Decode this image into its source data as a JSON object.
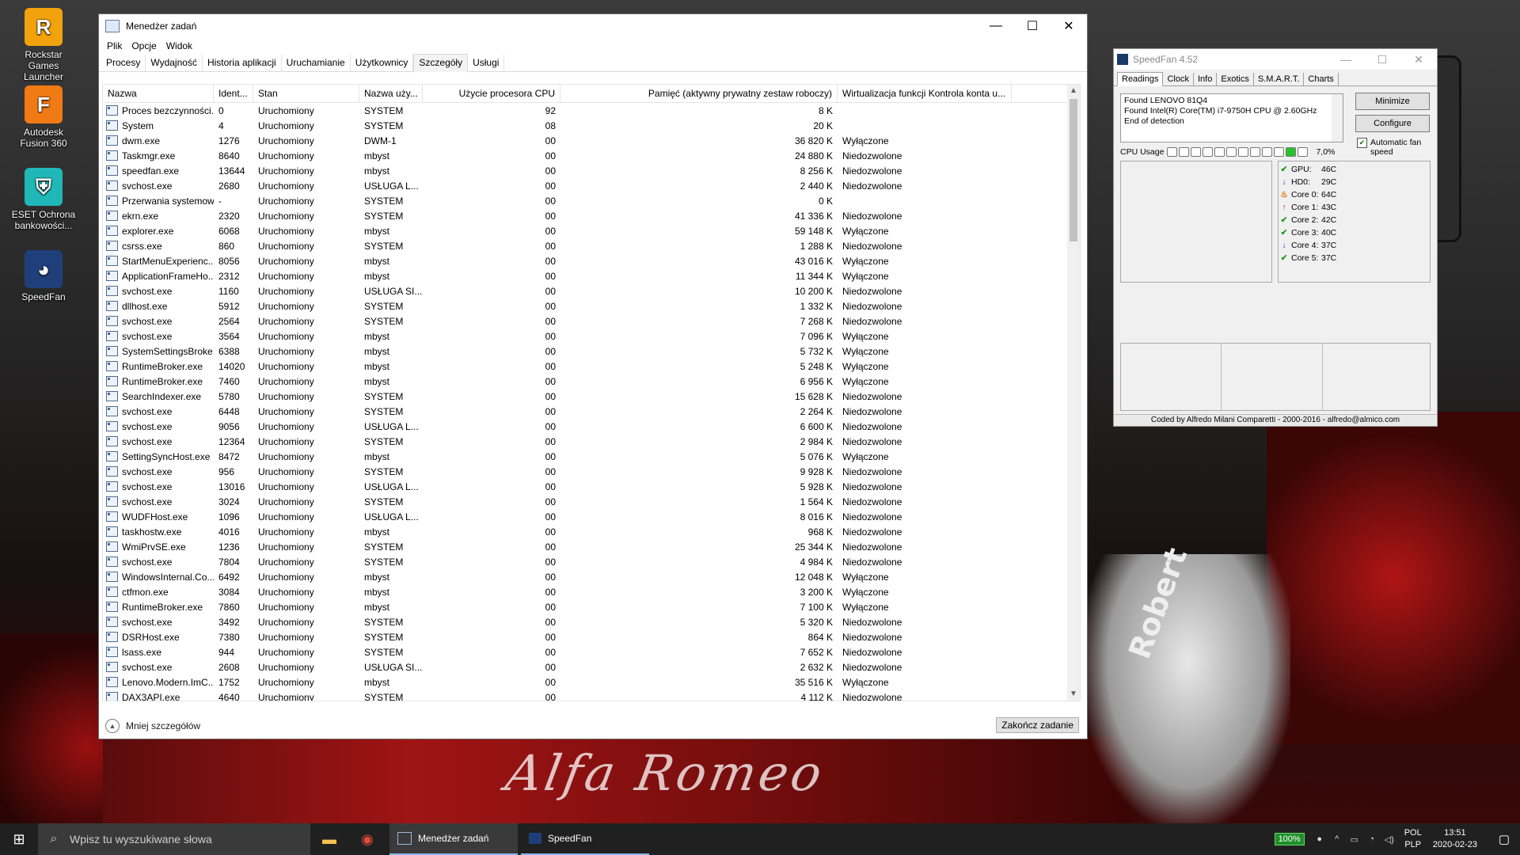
{
  "desktop": {
    "icons": [
      {
        "label": "Rockstar Games Launcher",
        "glyph": "R",
        "color": "#f1a20c"
      },
      {
        "label": "Autodesk Fusion 360",
        "glyph": "F",
        "color": "#f07a14"
      },
      {
        "label": "ESET Ochrona bankowości...",
        "glyph": "⛨",
        "color": "#1fb7b7"
      },
      {
        "label": "SpeedFan",
        "glyph": "◕",
        "color": "#1f3f7a"
      }
    ],
    "wallpaper_text": "Alfa Romeo",
    "glove_text": "Robert"
  },
  "taskmanager": {
    "title": "Menedżer zadań",
    "menu": [
      "Plik",
      "Opcje",
      "Widok"
    ],
    "tabs": [
      "Procesy",
      "Wydajność",
      "Historia aplikacji",
      "Uruchamianie",
      "Użytkownicy",
      "Szczegóły",
      "Usługi"
    ],
    "active_tab": "Szczegóły",
    "columns": [
      "Nazwa",
      "Ident...",
      "Stan",
      "Nazwa uży...",
      "Użycie procesora CPU",
      "Pamięć (aktywny prywatny zestaw roboczy)",
      "Wirtualizacja funkcji Kontrola konta u..."
    ],
    "rows": [
      [
        "Proces bezczynności...",
        "0",
        "Uruchomiony",
        "SYSTEM",
        "92",
        "8 K",
        ""
      ],
      [
        "System",
        "4",
        "Uruchomiony",
        "SYSTEM",
        "08",
        "20 K",
        ""
      ],
      [
        "dwm.exe",
        "1276",
        "Uruchomiony",
        "DWM-1",
        "00",
        "36 820 K",
        "Wyłączone"
      ],
      [
        "Taskmgr.exe",
        "8640",
        "Uruchomiony",
        "mbyst",
        "00",
        "24 880 K",
        "Niedozwolone"
      ],
      [
        "speedfan.exe",
        "13644",
        "Uruchomiony",
        "mbyst",
        "00",
        "8 256 K",
        "Niedozwolone"
      ],
      [
        "svchost.exe",
        "2680",
        "Uruchomiony",
        "USŁUGA L...",
        "00",
        "2 440 K",
        "Niedozwolone"
      ],
      [
        "Przerwania systemowe",
        "-",
        "Uruchomiony",
        "SYSTEM",
        "00",
        "0 K",
        ""
      ],
      [
        "ekrn.exe",
        "2320",
        "Uruchomiony",
        "SYSTEM",
        "00",
        "41 336 K",
        "Niedozwolone"
      ],
      [
        "explorer.exe",
        "6068",
        "Uruchomiony",
        "mbyst",
        "00",
        "59 148 K",
        "Wyłączone"
      ],
      [
        "csrss.exe",
        "860",
        "Uruchomiony",
        "SYSTEM",
        "00",
        "1 288 K",
        "Niedozwolone"
      ],
      [
        "StartMenuExperienc...",
        "8056",
        "Uruchomiony",
        "mbyst",
        "00",
        "43 016 K",
        "Wyłączone"
      ],
      [
        "ApplicationFrameHo...",
        "2312",
        "Uruchomiony",
        "mbyst",
        "00",
        "11 344 K",
        "Wyłączone"
      ],
      [
        "svchost.exe",
        "1160",
        "Uruchomiony",
        "USŁUGA SI...",
        "00",
        "10 200 K",
        "Niedozwolone"
      ],
      [
        "dllhost.exe",
        "5912",
        "Uruchomiony",
        "SYSTEM",
        "00",
        "1 332 K",
        "Niedozwolone"
      ],
      [
        "svchost.exe",
        "2564",
        "Uruchomiony",
        "SYSTEM",
        "00",
        "7 268 K",
        "Niedozwolone"
      ],
      [
        "svchost.exe",
        "3564",
        "Uruchomiony",
        "mbyst",
        "00",
        "7 096 K",
        "Wyłączone"
      ],
      [
        "SystemSettingsBroke...",
        "6388",
        "Uruchomiony",
        "mbyst",
        "00",
        "5 732 K",
        "Wyłączone"
      ],
      [
        "RuntimeBroker.exe",
        "14020",
        "Uruchomiony",
        "mbyst",
        "00",
        "5 248 K",
        "Wyłączone"
      ],
      [
        "RuntimeBroker.exe",
        "7460",
        "Uruchomiony",
        "mbyst",
        "00",
        "6 956 K",
        "Wyłączone"
      ],
      [
        "SearchIndexer.exe",
        "5780",
        "Uruchomiony",
        "SYSTEM",
        "00",
        "15 628 K",
        "Niedozwolone"
      ],
      [
        "svchost.exe",
        "6448",
        "Uruchomiony",
        "SYSTEM",
        "00",
        "2 264 K",
        "Niedozwolone"
      ],
      [
        "svchost.exe",
        "9056",
        "Uruchomiony",
        "USŁUGA L...",
        "00",
        "6 600 K",
        "Niedozwolone"
      ],
      [
        "svchost.exe",
        "12364",
        "Uruchomiony",
        "SYSTEM",
        "00",
        "2 984 K",
        "Niedozwolone"
      ],
      [
        "SettingSyncHost.exe",
        "8472",
        "Uruchomiony",
        "mbyst",
        "00",
        "5 076 K",
        "Wyłączone"
      ],
      [
        "svchost.exe",
        "956",
        "Uruchomiony",
        "SYSTEM",
        "00",
        "9 928 K",
        "Niedozwolone"
      ],
      [
        "svchost.exe",
        "13016",
        "Uruchomiony",
        "USŁUGA L...",
        "00",
        "5 928 K",
        "Niedozwolone"
      ],
      [
        "svchost.exe",
        "3024",
        "Uruchomiony",
        "SYSTEM",
        "00",
        "1 564 K",
        "Niedozwolone"
      ],
      [
        "WUDFHost.exe",
        "1096",
        "Uruchomiony",
        "USŁUGA L...",
        "00",
        "8 016 K",
        "Niedozwolone"
      ],
      [
        "taskhostw.exe",
        "4016",
        "Uruchomiony",
        "mbyst",
        "00",
        "968 K",
        "Niedozwolone"
      ],
      [
        "WmiPrvSE.exe",
        "1236",
        "Uruchomiony",
        "SYSTEM",
        "00",
        "25 344 K",
        "Niedozwolone"
      ],
      [
        "svchost.exe",
        "7804",
        "Uruchomiony",
        "SYSTEM",
        "00",
        "4 984 K",
        "Niedozwolone"
      ],
      [
        "WindowsInternal.Co...",
        "6492",
        "Uruchomiony",
        "mbyst",
        "00",
        "12 048 K",
        "Wyłączone"
      ],
      [
        "ctfmon.exe",
        "3084",
        "Uruchomiony",
        "mbyst",
        "00",
        "3 200 K",
        "Wyłączone"
      ],
      [
        "RuntimeBroker.exe",
        "7860",
        "Uruchomiony",
        "mbyst",
        "00",
        "7 100 K",
        "Wyłączone"
      ],
      [
        "svchost.exe",
        "3492",
        "Uruchomiony",
        "SYSTEM",
        "00",
        "5 320 K",
        "Niedozwolone"
      ],
      [
        "DSRHost.exe",
        "7380",
        "Uruchomiony",
        "SYSTEM",
        "00",
        "864 K",
        "Niedozwolone"
      ],
      [
        "lsass.exe",
        "944",
        "Uruchomiony",
        "SYSTEM",
        "00",
        "7 652 K",
        "Niedozwolone"
      ],
      [
        "svchost.exe",
        "2608",
        "Uruchomiony",
        "USŁUGA SI...",
        "00",
        "2 632 K",
        "Niedozwolone"
      ],
      [
        "Lenovo.Modern.ImC...",
        "1752",
        "Uruchomiony",
        "mbyst",
        "00",
        "35 516 K",
        "Wyłączone"
      ],
      [
        "DAX3API.exe",
        "4640",
        "Uruchomiony",
        "SYSTEM",
        "00",
        "4 112 K",
        "Niedozwolone"
      ]
    ],
    "footer": {
      "less_details": "Mniej szczegółów",
      "end_task": "Zakończ zadanie"
    }
  },
  "speedfan": {
    "title": "SpeedFan 4.52",
    "tabs": [
      "Readings",
      "Clock",
      "Info",
      "Exotics",
      "S.M.A.R.T.",
      "Charts"
    ],
    "active_tab": "Readings",
    "log": [
      "Found LENOVO 81Q4",
      "Found Intel(R) Core(TM) i7-9750H CPU @ 2.60GHz",
      "End of detection"
    ],
    "buttons": {
      "minimize": "Minimize",
      "configure": "Configure"
    },
    "auto_fan_label": "Automatic fan speed",
    "auto_fan_checked": true,
    "cpu_usage_label": "CPU Usage",
    "cpu_usage_value": "7,0%",
    "cpu_cells_total": 12,
    "cpu_cells_on": 1,
    "temps": [
      {
        "label": "GPU:",
        "value": "46C",
        "status": "ok"
      },
      {
        "label": "HD0:",
        "value": "29C",
        "status": "down"
      },
      {
        "label": "Core 0:",
        "value": "64C",
        "status": "hot"
      },
      {
        "label": "Core 1:",
        "value": "43C",
        "status": "up"
      },
      {
        "label": "Core 2:",
        "value": "42C",
        "status": "ok"
      },
      {
        "label": "Core 3:",
        "value": "40C",
        "status": "ok"
      },
      {
        "label": "Core 4:",
        "value": "37C",
        "status": "down"
      },
      {
        "label": "Core 5:",
        "value": "37C",
        "status": "ok"
      }
    ],
    "credit": "Coded by Alfredo Milani Comparetti - 2000-2016 - alfredo@almico.com"
  },
  "taskbar": {
    "search_placeholder": "Wpisz tu wyszukiwane słowa",
    "apps": [
      "Menedżer zadań",
      "SpeedFan"
    ],
    "battery": "100%",
    "lang_top": "POL",
    "lang_bottom": "PLP",
    "time": "13:51",
    "date": "2020-02-23"
  }
}
